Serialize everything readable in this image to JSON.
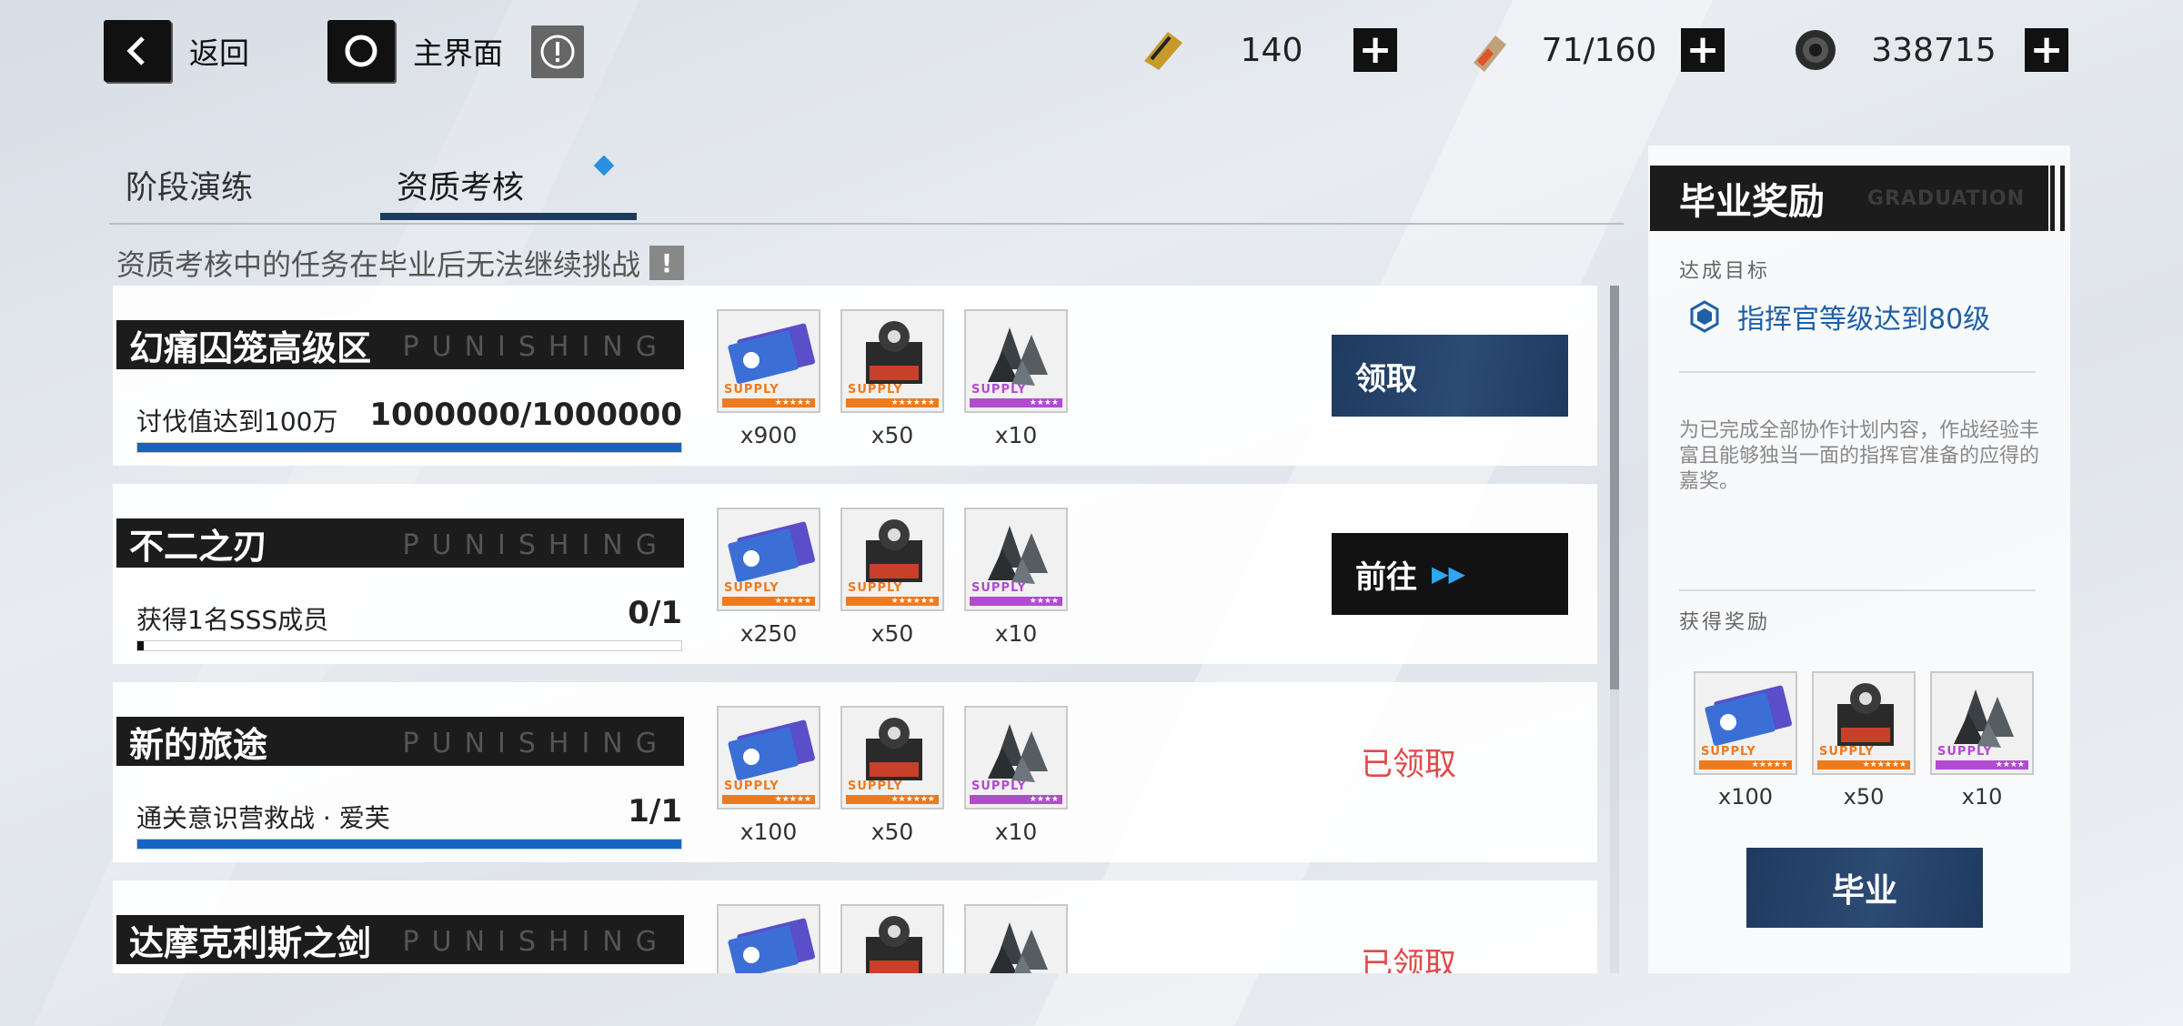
{
  "topbar": {
    "back_label": "返回",
    "home_label": "主界面",
    "resources": [
      {
        "icon": "ticket-icon",
        "value": "140"
      },
      {
        "icon": "battery-icon",
        "value": "71/160"
      },
      {
        "icon": "gear-coin-icon",
        "value": "338715"
      }
    ]
  },
  "tabs": [
    {
      "label": "阶段演练",
      "selected": false
    },
    {
      "label": "资质考核",
      "selected": true
    }
  ],
  "notice": "资质考核中的任务在毕业后无法继续挑战",
  "deco_text": "PUNISHING",
  "tasks": [
    {
      "title": "幻痛囚笼高级区",
      "condition": "讨伐值达到100万",
      "progress": "1000000/1000000",
      "progress_fraction": 1.0,
      "rewards": [
        "x900",
        "x50",
        "x10"
      ],
      "action": {
        "type": "button",
        "label": "领取",
        "style": "blue"
      }
    },
    {
      "title": "不二之刃",
      "condition": "获得1名SSS成员",
      "progress": "0/1",
      "progress_fraction": 0.0,
      "rewards": [
        "x250",
        "x50",
        "x10"
      ],
      "action": {
        "type": "button",
        "label": "前往",
        "style": "dark"
      }
    },
    {
      "title": "新的旅途",
      "condition": "通关意识营救战 · 爱芙",
      "progress": "1/1",
      "progress_fraction": 1.0,
      "rewards": [
        "x100",
        "x50",
        "x10"
      ],
      "action": {
        "type": "claimed",
        "label": "已领取"
      }
    },
    {
      "title": "达摩克利斯之剑",
      "condition": "",
      "progress": "",
      "progress_fraction": null,
      "rewards": [
        "",
        "",
        ""
      ],
      "action": {
        "type": "claimed",
        "label": "已领取"
      }
    }
  ],
  "graduation": {
    "title": "毕业奖励",
    "title_en": "GRADUATION",
    "goal_header": "达成目标",
    "goal": "指挥官等级达到80级",
    "description": "为已完成全部协作计划内容，作战经验丰富且能够独当一面的指挥官准备的应得的嘉奖。",
    "rewards_header": "获得奖励",
    "rewards": [
      "x100",
      "x50",
      "x10"
    ],
    "button_label": "毕业"
  },
  "colors": {
    "accent_blue": "#1565c0",
    "claimed_red": "#e04a4a",
    "button_blue": "#1e3a5f",
    "supply_orange": "#ee7a1e",
    "supply_purple": "#b24bd0"
  }
}
